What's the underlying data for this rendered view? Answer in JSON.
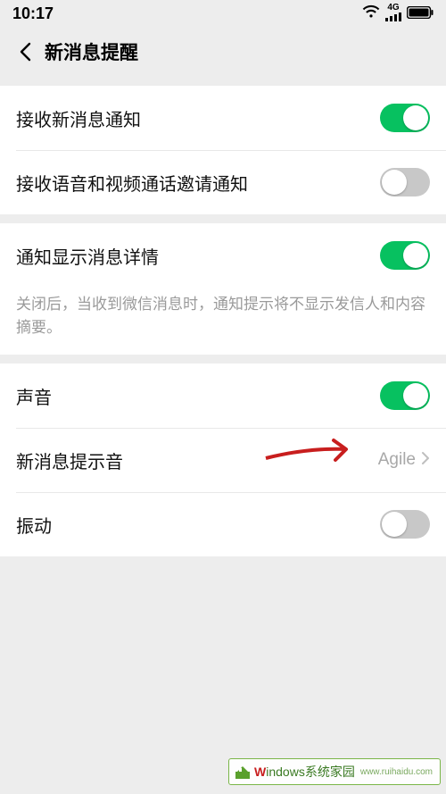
{
  "status": {
    "time": "10:17",
    "network_label": "4G"
  },
  "header": {
    "title": "新消息提醒"
  },
  "group1": {
    "receive_msg": {
      "label": "接收新消息通知",
      "on": true
    },
    "receive_call": {
      "label": "接收语音和视频通话邀请通知",
      "on": false
    }
  },
  "group2": {
    "show_detail": {
      "label": "通知显示消息详情",
      "on": true
    },
    "note": "关闭后，当收到微信消息时，通知提示将不显示发信人和内容摘要。"
  },
  "group3": {
    "sound": {
      "label": "声音",
      "on": true
    },
    "tone": {
      "label": "新消息提示音",
      "value": "Agile"
    },
    "vibrate": {
      "label": "振动",
      "on": false
    }
  },
  "watermark": {
    "brand": "indows",
    "tagline": "系统家园",
    "url": "www.ruihaidu.com"
  }
}
